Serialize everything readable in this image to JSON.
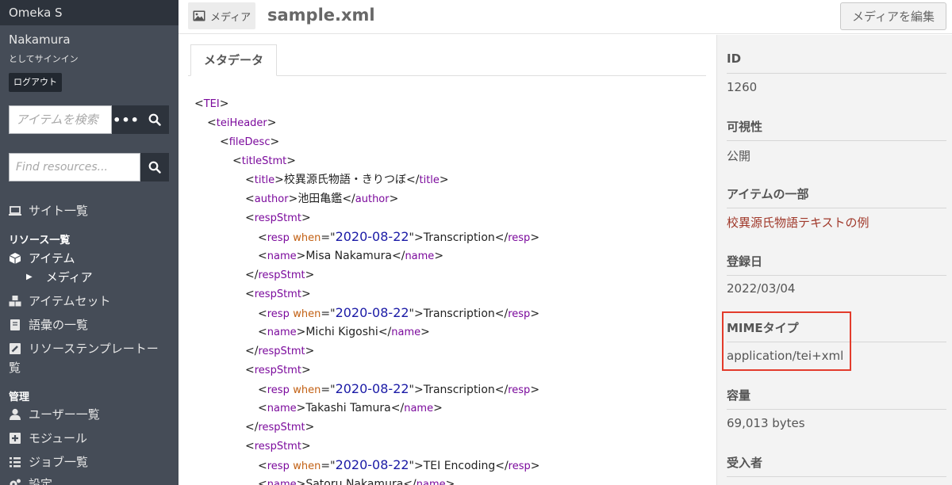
{
  "sidebar": {
    "brand": "Omeka S",
    "user_name": "Nakamura",
    "signed_in_as": "としてサインイン",
    "logout": "ログアウト",
    "item_search_placeholder": "アイテムを検索",
    "resource_search_placeholder": "Find resources...",
    "nav": {
      "sites": "サイト一覧",
      "resources_heading": "リソース一覧",
      "items": "アイテム",
      "media": "メディア",
      "item_sets": "アイテムセット",
      "vocabularies": "語彙の一覧",
      "resource_templates_1": "リソーステンプレートー",
      "resource_templates_2": "覧",
      "admin_heading": "管理",
      "users": "ユーザー一覧",
      "modules": "モジュール",
      "jobs": "ジョブ一覧",
      "settings": "設定"
    }
  },
  "header": {
    "crumb": "メディア",
    "title": "sample.xml",
    "edit_button": "メディアを編集"
  },
  "main": {
    "tab": "メタデータ"
  },
  "xml": {
    "tei": "TEI",
    "teiHeader": "teiHeader",
    "fileDesc": "fileDesc",
    "titleStmt": "titleStmt",
    "title_tag": "title",
    "title_text": "校異源氏物語・きりつぼ",
    "author_tag": "author",
    "author_text": "池田亀鑑",
    "respStmt": "respStmt",
    "resp_tag": "resp",
    "when_attr": "when",
    "date": "2020-08-22",
    "transcription": "Transcription",
    "tei_encoding": "TEI Encoding",
    "name_tag": "name",
    "names": [
      "Misa Nakamura",
      "Michi Kigoshi",
      "Takashi Tamura",
      "Satoru Nakamura"
    ]
  },
  "panel": {
    "id_label": "ID",
    "id_value": "1260",
    "visibility_label": "可視性",
    "visibility_value": "公開",
    "item_label": "アイテムの一部",
    "item_value": "校異源氏物語テキストの例",
    "created_label": "登録日",
    "created_value": "2022/03/04",
    "mime_label": "MIMEタイプ",
    "mime_value": "application/tei+xml",
    "size_label": "容量",
    "size_value": "69,013 bytes",
    "owner_label": "受入者"
  },
  "colors": {
    "sidebar_bg": "#454c57",
    "link": "#a0392b",
    "highlight": "#e33b2b",
    "xml_tag": "#7b0a9c",
    "xml_attr": "#c26013",
    "xml_value": "#1a1aa6"
  }
}
